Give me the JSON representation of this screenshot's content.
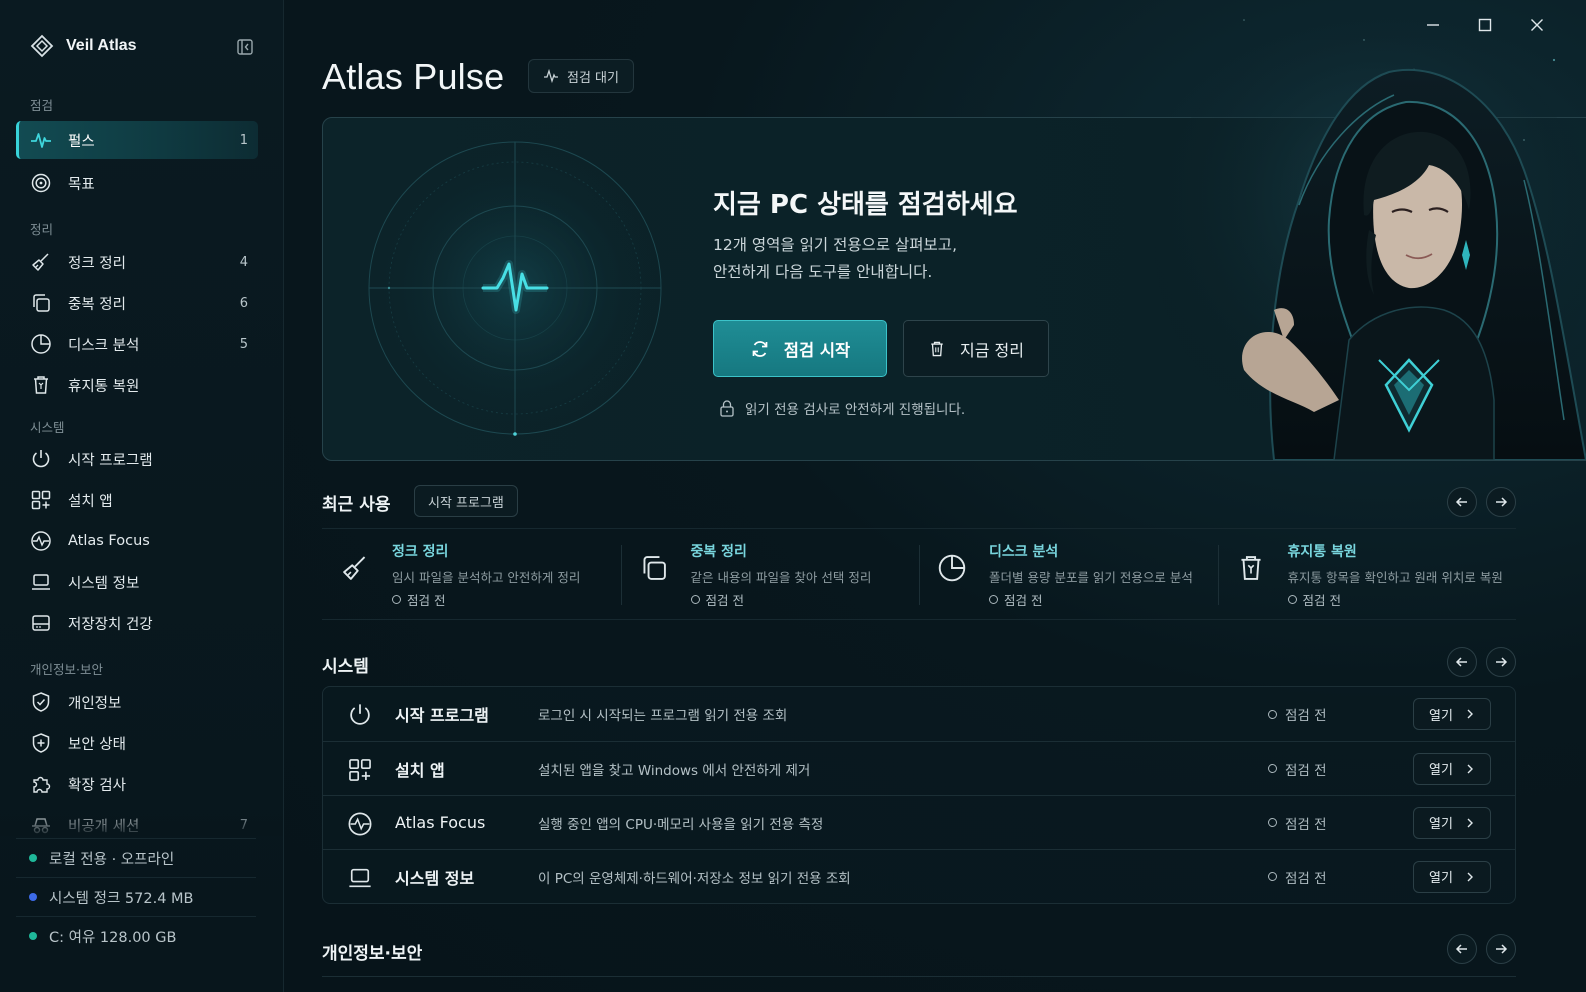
{
  "app": {
    "name": "Veil Atlas"
  },
  "sidebar": {
    "sections": [
      {
        "label": "점검"
      },
      {
        "label": "정리"
      },
      {
        "label": "시스템"
      },
      {
        "label": "개인정보·보안"
      }
    ],
    "items": [
      {
        "label": "펄스",
        "icon": "pulse-icon",
        "count": "1",
        "active": true
      },
      {
        "label": "목표",
        "icon": "target-icon",
        "count": ""
      },
      {
        "label": "정크 정리",
        "icon": "broom-icon",
        "count": "4"
      },
      {
        "label": "중복 정리",
        "icon": "copy-icon",
        "count": "6"
      },
      {
        "label": "디스크 분석",
        "icon": "pie-chart-icon",
        "count": "5"
      },
      {
        "label": "휴지통 복원",
        "icon": "trash-icon",
        "count": ""
      },
      {
        "label": "시작 프로그램",
        "icon": "power-icon",
        "count": ""
      },
      {
        "label": "설치 앱",
        "icon": "apps-grid-icon",
        "count": ""
      },
      {
        "label": "Atlas Focus",
        "icon": "focus-pulse-icon",
        "count": ""
      },
      {
        "label": "시스템 정보",
        "icon": "laptop-icon",
        "count": ""
      },
      {
        "label": "저장장치 건강",
        "icon": "drive-icon",
        "count": ""
      },
      {
        "label": "개인정보",
        "icon": "shield-check-icon",
        "count": ""
      },
      {
        "label": "보안 상태",
        "icon": "shield-plus-icon",
        "count": ""
      },
      {
        "label": "확장 검사",
        "icon": "puzzle-icon",
        "count": ""
      },
      {
        "label": "비공개 세션",
        "icon": "incognito-icon",
        "count": "7"
      }
    ],
    "status": [
      {
        "text": "로컬 전용 · 오프라인",
        "color": "#1fb89a"
      },
      {
        "text": "시스템 정크 572.4 MB",
        "color": "#3d6be8"
      },
      {
        "text": "C: 여유 128.00 GB",
        "color": "#1fb89a"
      }
    ]
  },
  "header": {
    "title": "Atlas Pulse",
    "status_chip": "점검 대기"
  },
  "hero": {
    "title": "지금 PC 상태를 점검하세요",
    "subtitle_line1": "12개 영역을 읽기 전용으로 살펴보고,",
    "subtitle_line2": "안전하게 다음 도구를 안내합니다.",
    "primary_button": "점검 시작",
    "secondary_button": "지금 정리",
    "note": "읽기 전용 검사로 안전하게 진행됩니다."
  },
  "recent": {
    "title": "최근 사용",
    "chip": "시작 프로그램",
    "cards": [
      {
        "title": "정크 정리",
        "desc": "임시 파일을 분석하고 안전하게 정리",
        "status": "점검 전",
        "icon": "broom-icon"
      },
      {
        "title": "중복 정리",
        "desc": "같은 내용의 파일을 찾아 선택 정리",
        "status": "점검 전",
        "icon": "copy-icon"
      },
      {
        "title": "디스크 분석",
        "desc": "폴더별 용량 분포를 읽기 전용으로 분석",
        "status": "점검 전",
        "icon": "pie-chart-icon"
      },
      {
        "title": "휴지통 복원",
        "desc": "휴지통 항목을 확인하고 원래 위치로 복원",
        "status": "점검 전",
        "icon": "trash-icon"
      }
    ]
  },
  "system": {
    "title": "시스템",
    "rows": [
      {
        "title": "시작 프로그램",
        "desc": "로그인 시 시작되는 프로그램 읽기 전용 조회",
        "status": "점검 전",
        "open": "열기",
        "icon": "power-icon"
      },
      {
        "title": "설치 앱",
        "desc": "설치된 앱을 찾고 Windows 에서 안전하게 제거",
        "status": "점검 전",
        "open": "열기",
        "icon": "apps-grid-icon"
      },
      {
        "title": "Atlas Focus",
        "desc": "실행 중인 앱의 CPU·메모리 사용을 읽기 전용 측정",
        "status": "점검 전",
        "open": "열기",
        "icon": "focus-pulse-icon"
      },
      {
        "title": "시스템 정보",
        "desc": "이 PC의 운영체제·하드웨어·저장소 정보 읽기 전용 조회",
        "status": "점검 전",
        "open": "열기",
        "icon": "laptop-icon"
      }
    ]
  },
  "privacy": {
    "title": "개인정보·보안"
  },
  "colors": {
    "accent": "#38d3d9",
    "primary_button": "#1a8189",
    "background": "#07161d"
  }
}
